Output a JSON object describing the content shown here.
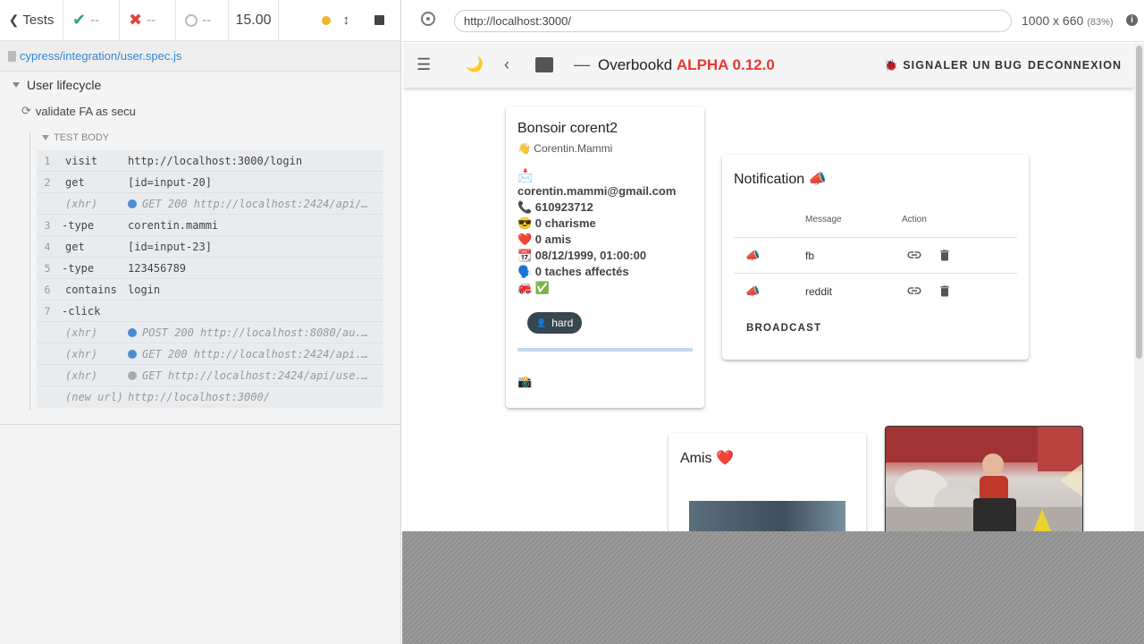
{
  "runner": {
    "back_label": "Tests",
    "passed": "--",
    "failed": "--",
    "pending": "--",
    "duration": "15.00",
    "spec_file": "cypress/integration/user.spec.js",
    "suite": "User lifecycle",
    "test": "validate FA as secu",
    "section": "TEST BODY",
    "commands": [
      {
        "num": "1",
        "name": "visit",
        "msg": "http://localhost:3000/login"
      },
      {
        "num": "2",
        "name": "get",
        "msg": "[id=input-20]"
      },
      {
        "num": "",
        "name": "(xhr)",
        "msg": "GET 200 http://localhost:2424/api/..."
      },
      {
        "num": "3",
        "name": "-type",
        "msg": "corentin.mammi"
      },
      {
        "num": "4",
        "name": "get",
        "msg": "[id=input-23]"
      },
      {
        "num": "5",
        "name": "-type",
        "msg": "123456789"
      },
      {
        "num": "6",
        "name": "contains",
        "msg": "login"
      },
      {
        "num": "7",
        "name": "-click",
        "msg": ""
      },
      {
        "num": "",
        "name": "(xhr)",
        "msg": "POST 200 http://localhost:8080/au..."
      },
      {
        "num": "",
        "name": "(xhr)",
        "msg": "GET 200 http://localhost:2424/api..."
      },
      {
        "num": "",
        "name": "(xhr)",
        "msg": "GET http://localhost:2424/api/use..."
      },
      {
        "num": "",
        "name": "(new url)",
        "msg": "http://localhost:3000/"
      }
    ]
  },
  "browser": {
    "url": "http://localhost:3000/",
    "viewport": "1000 x 660",
    "zoom": "(83%)"
  },
  "app": {
    "title": "Overbookd",
    "version": "ALPHA 0.12.0",
    "report_bug": "🐞 SIGNALER UN BUG",
    "logout": "DECONNEXION",
    "profile": {
      "greeting": "Bonsoir corent2",
      "username": "👋 Corentin.Mammi",
      "mail_icon": "📩",
      "email": "corentin.mammi@gmail.com",
      "phone": "📞 610923712",
      "charisma": "😎 0 charisme",
      "friends": "❤️ 0 amis",
      "birthdate": "📆 08/12/1999, 01:00:00",
      "tasks": "🗣️ 0 taches affectés",
      "transport": "🚒 ✅",
      "team_chip": "hard",
      "footer_icon": "📸"
    },
    "notifications": {
      "title": "Notification 📣",
      "col_message": "Message",
      "col_action": "Action",
      "rows": [
        {
          "icon": "📣",
          "message": "fb"
        },
        {
          "icon": "📣",
          "message": "reddit"
        }
      ],
      "broadcast": "BROADCAST"
    },
    "friends_title": "Amis ❤️"
  },
  "colors": {
    "accent_red": "#e53935",
    "pass_green": "#2fa56a",
    "fail_red": "#e0443e",
    "link_blue": "#3386d6"
  }
}
